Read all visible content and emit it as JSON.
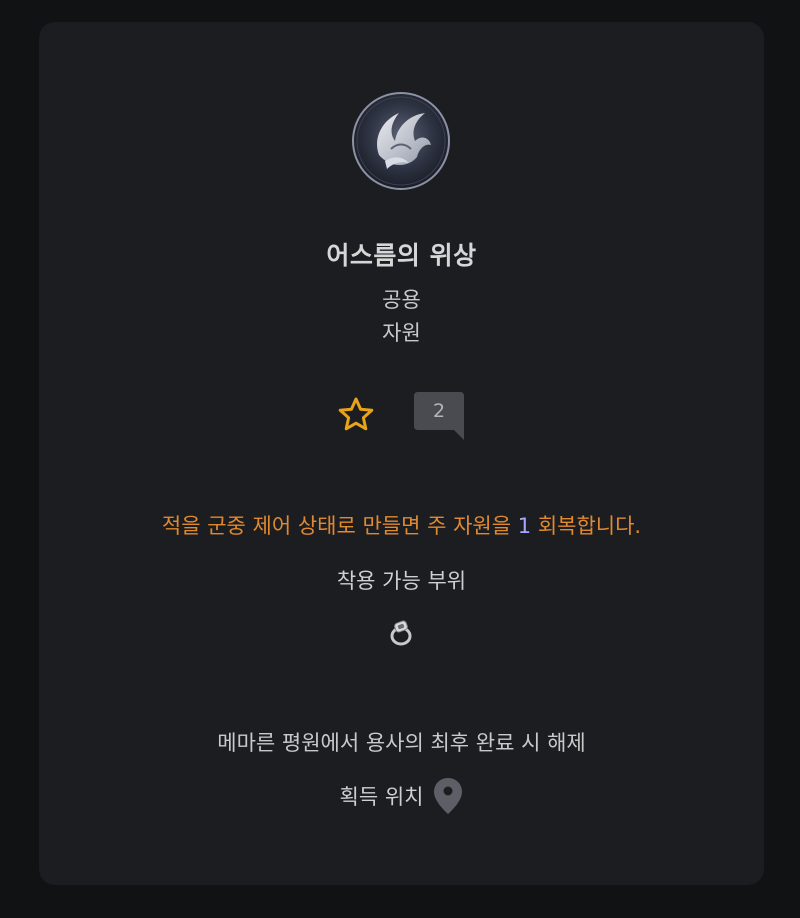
{
  "item": {
    "name": "어스름의 위상",
    "category": "공용",
    "type": "자원",
    "icon": "crescent-flame-emblem-icon"
  },
  "actions": {
    "favorite_icon": "star-outline-icon",
    "comment_count": "2"
  },
  "effect": {
    "text_before": "적을 군중 제어 상태로 만들면 주 자원을 ",
    "value": "1",
    "text_after": " 회복합니다."
  },
  "slots": {
    "label": "착용 가능 부위",
    "icon": "ring-icon"
  },
  "unlock": {
    "text": "메마른 평원에서 용사의 최후 완료 시 해제"
  },
  "location": {
    "label": "획득 위치",
    "icon": "map-pin-icon"
  },
  "colors": {
    "background": "#111214",
    "card": "#1c1d21",
    "effect_text": "#e0892f",
    "effect_value": "#a9a6ff",
    "star": "#e8a317",
    "badge": "#4a4b50"
  }
}
